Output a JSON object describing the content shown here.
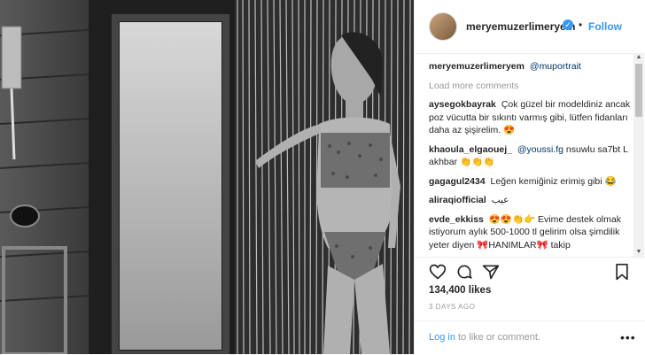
{
  "header": {
    "username": "meryemuzerlimeryem",
    "verified_glyph": "✓",
    "separator": "•",
    "follow_label": "Follow"
  },
  "caption": {
    "username": "meryemuzerlimeryem",
    "mention": "@muportrait"
  },
  "load_more_label": "Load more comments",
  "comments": [
    {
      "username": "aysegokbayrak",
      "text": "Çok güzel bir modeldiniz ancak poz vücutta bir sıkıntı varmış gibi, lütfen fidanları daha az şişirelim. 😍"
    },
    {
      "username": "khaoula_elgaouej_",
      "mention": "@youssi.fg",
      "text": "nsuwlu sa7bt L akhbar 👏👏👏"
    },
    {
      "username": "gagagul2434",
      "text": "Leğen kemiğiniz erimiş gibi 😂"
    },
    {
      "username": "aliraqiofficial",
      "text": "عيب"
    },
    {
      "username": "evde_ekkiss",
      "text": "😍😍👏👉 Evime destek olmak istiyorum aylık 500-1000 tl gelirim olsa şimdilik yeter diyen 🎀HANIMLAR🎀 takip"
    }
  ],
  "scrollbar": {
    "up": "▲",
    "down": "▼"
  },
  "likes_text": "134,400 likes",
  "time_ago": "3 DAYS AGO",
  "login": {
    "link": "Log in",
    "rest": " to like or comment.",
    "more_glyph": "•••"
  },
  "colors": {
    "link": "#3897f0",
    "mention": "#003569",
    "muted": "#999999"
  }
}
